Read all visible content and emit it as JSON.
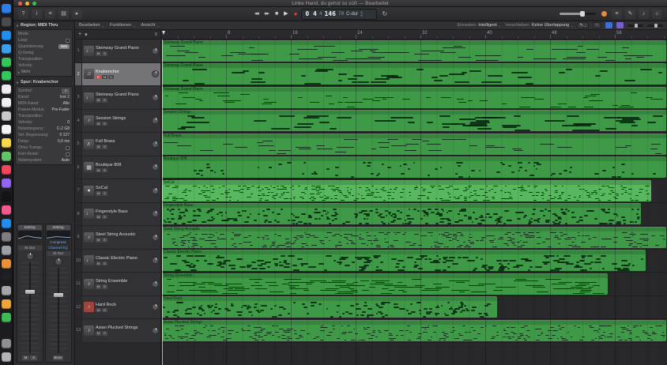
{
  "window": {
    "title": "Linke Hand, du gehst so süß — Bearbeitet"
  },
  "glyphs": {
    "chevron": "⌄",
    "disclosure_open": "▼",
    "disclosure_closed": "▸",
    "symbol": "♫"
  },
  "dock": {
    "items": [
      {
        "name": "finder",
        "color": "#2e7de9"
      },
      {
        "name": "launchpad",
        "color": "#4a4a4e"
      },
      {
        "name": "safari",
        "color": "#1f8ef0"
      },
      {
        "name": "mail",
        "color": "#3aa0f0"
      },
      {
        "name": "messages",
        "color": "#34c759"
      },
      {
        "name": "facetime",
        "color": "#34c759"
      },
      {
        "name": "photos",
        "color": "#ededf0"
      },
      {
        "name": "calendar",
        "color": "#f0f0f2"
      },
      {
        "name": "contacts",
        "color": "#c8c8cc"
      },
      {
        "name": "reminders",
        "color": "#f5f5f7"
      },
      {
        "name": "notes",
        "color": "#f9d84a"
      },
      {
        "name": "maps",
        "color": "#63c466"
      },
      {
        "name": "music",
        "color": "#f3455b"
      },
      {
        "name": "podcasts",
        "color": "#9265f5"
      },
      {
        "name": "tv",
        "color": "#141416"
      },
      {
        "name": "news",
        "color": "#f5588d"
      },
      {
        "name": "appstore",
        "color": "#1f8ef0"
      },
      {
        "name": "system-preferences",
        "color": "#7d7d82"
      },
      {
        "name": "logic-pro",
        "color": "#9aa0a6"
      },
      {
        "name": "garageband",
        "color": "#e8903a"
      },
      {
        "name": "terminal",
        "color": "#202024"
      },
      {
        "name": "activity-monitor",
        "color": "#a6a6ab"
      },
      {
        "name": "pages",
        "color": "#f2a33c"
      },
      {
        "name": "numbers",
        "color": "#3fb954"
      },
      {
        "name": "downloads",
        "color": "#8e8e93",
        "gap": true
      },
      {
        "name": "trash",
        "color": "#b3b3b8"
      }
    ]
  },
  "control_bar": {
    "left_icons": [
      {
        "name": "quick-help-icon",
        "glyph": "?"
      },
      {
        "name": "inspector-icon",
        "glyph": "i"
      },
      {
        "name": "toolbar-icon",
        "glyph": "≡"
      },
      {
        "name": "mixer-icon",
        "glyph": "▤"
      },
      {
        "name": "editors-icon",
        "glyph": "▸"
      }
    ],
    "transport": {
      "rewind": "◂◂",
      "forward": "▸▸",
      "stop": "■",
      "play": "▶",
      "record": "●"
    },
    "lcd": {
      "position": "0 4",
      "beat": "4",
      "tempo": "146",
      "secondary": "70",
      "key": "C-dur",
      "timesig_top": "4",
      "timesig_bottom": "4"
    },
    "cycle_glyph": "↻",
    "right_icons": [
      {
        "name": "list-editors-icon",
        "glyph": "≡"
      },
      {
        "name": "note-pads-icon",
        "glyph": "✎"
      },
      {
        "name": "apple-loops-icon",
        "glyph": "♪"
      },
      {
        "name": "browsers-icon",
        "glyph": "⌂"
      }
    ]
  },
  "tracks_toolbar": {
    "menus": [
      "Bearbeiten",
      "Funktionen",
      "Ansicht"
    ],
    "snap_label": "Einrasten:",
    "snap_value": "Intelligent",
    "drag_label": "Verschieben:",
    "drag_value": "Keine Überlappung",
    "tool1": "↖",
    "tool2": "↖"
  },
  "header_tools": {
    "add": "+",
    "menu": "▾",
    "config": "≡"
  },
  "ruler": {
    "labels": [
      "8",
      "16",
      "24",
      "32",
      "40",
      "48",
      "56"
    ]
  },
  "inspector": {
    "region": {
      "title": "Region: MIDI Thru",
      "rows": [
        {
          "label": "Mode:",
          "value": ""
        },
        {
          "label": "Loop:",
          "value": "",
          "type": "checkbox"
        },
        {
          "label": "Quantisierung:",
          "value": "aus",
          "type": "pill"
        },
        {
          "label": "Q-Swing:",
          "value": ""
        },
        {
          "label": "Transposition:",
          "value": ""
        },
        {
          "label": "Velocity:",
          "value": ""
        },
        {
          "label": "Mehr",
          "value": "",
          "type": "more"
        }
      ]
    },
    "track": {
      "title": "Spur: Knabenchor",
      "rows": [
        {
          "label": "Symbol:",
          "value": "",
          "type": "icon"
        },
        {
          "label": "Kanal:",
          "value": "Inst 2"
        },
        {
          "label": "MIDI-Kanal:",
          "value": "Alle"
        },
        {
          "label": "Freeze-Modus:",
          "value": "Pre-Fader"
        },
        {
          "label": "Transposition:",
          "value": ""
        },
        {
          "label": "Velocity:",
          "value": "0"
        },
        {
          "label": "Notenbegrenz.:",
          "value": "C-2 G8"
        },
        {
          "label": "Vel.-Begrenzung:",
          "value": "0 127"
        },
        {
          "label": "Delay:",
          "value": "0,0 ms"
        },
        {
          "label": "Ohne Transp.:",
          "value": "",
          "type": "checkbox"
        },
        {
          "label": "Kein Reset:",
          "value": "",
          "type": "checkbox"
        },
        {
          "label": "Notensystem:",
          "value": "Auto"
        }
      ]
    }
  },
  "channel_strips": {
    "strip1": {
      "setting": "Setting",
      "plugins": [],
      "output": "St Out",
      "mute": "M",
      "solo": "S"
    },
    "strip2": {
      "setting": "Setting",
      "plugins": [
        "Compress",
        "Channel EQ"
      ],
      "output": "St Out",
      "bounce": "Bnce"
    }
  },
  "track_header_labels": {
    "record": "R",
    "mute": "M",
    "solo": "S"
  },
  "tracks": [
    {
      "num": 1,
      "name": "Steinway Grand Piano",
      "icon": "piano-icon",
      "glyph": "♩"
    },
    {
      "num": 2,
      "name": "Knabenchor",
      "icon": "choir-icon",
      "glyph": "♫",
      "selected": true
    },
    {
      "num": 3,
      "name": "Steinway Grand Piano",
      "icon": "piano-icon",
      "glyph": "♩"
    },
    {
      "num": 4,
      "name": "Session Strings",
      "icon": "strings-icon",
      "glyph": "♪"
    },
    {
      "num": 5,
      "name": "Full Brass",
      "icon": "brass-icon",
      "glyph": "♬"
    },
    {
      "num": 6,
      "name": "Boutique 808",
      "icon": "drum-machine-icon",
      "glyph": "▦"
    },
    {
      "num": 7,
      "name": "SoCal",
      "icon": "drummer-icon",
      "glyph": "●"
    },
    {
      "num": 8,
      "name": "Fingerstyle Bass",
      "icon": "bass-icon",
      "glyph": "♩"
    },
    {
      "num": 9,
      "name": "Steel String Acoustic",
      "icon": "acoustic-guitar-icon",
      "glyph": "♪"
    },
    {
      "num": 10,
      "name": "Classic Electric Piano",
      "icon": "electric-piano-icon",
      "glyph": "♩"
    },
    {
      "num": 11,
      "name": "String Ensemble",
      "icon": "strings-icon",
      "glyph": "♪"
    },
    {
      "num": 12,
      "name": "Hard Rock",
      "icon": "electric-guitar-icon",
      "glyph": "♪",
      "icon_color": "#a0443f"
    },
    {
      "num": 13,
      "name": "Asian Plucked Strings",
      "icon": "world-strings-icon",
      "glyph": "♪"
    }
  ],
  "regions": [
    {
      "name": "Steinway Grand Piano",
      "width": 1
    },
    {
      "name": "Steinway Grand Piano",
      "width": 1
    },
    {
      "name": "Steinway Grand Piano",
      "width": 1
    },
    {
      "name": "Session Strings",
      "width": 1
    },
    {
      "name": "Full Brass",
      "width": 1
    },
    {
      "name": "Boutique 808",
      "width": 1
    },
    {
      "name": "SoCal",
      "width": 0.97,
      "bright": true
    },
    {
      "name": "Fingerstyle Bass",
      "width": 0.95
    },
    {
      "name": "Steel String Acoustic",
      "width": 1
    },
    {
      "name": "Classic Electric Piano",
      "width": 0.96
    },
    {
      "name": "String Ensemble",
      "width": 0.885
    },
    {
      "name": "Hard Rock",
      "width": 0.665
    },
    {
      "name": "Asian Plucked Strings",
      "width": 1
    }
  ]
}
